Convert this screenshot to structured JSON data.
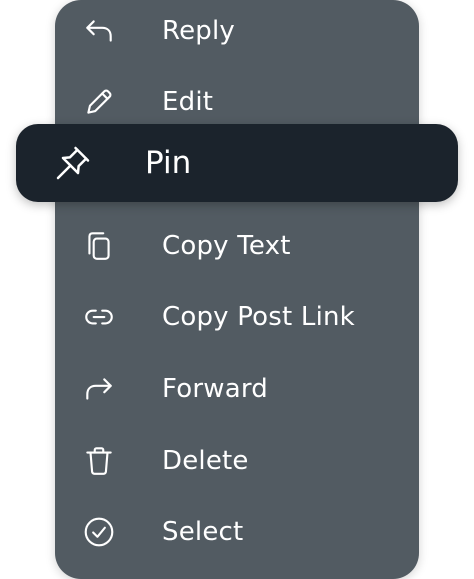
{
  "colors": {
    "menu_background": "#525b62",
    "highlight_background": "#1b232c",
    "text": "#ffffff",
    "page_background": "#ffffff"
  },
  "menu": {
    "items": [
      {
        "label": "Reply",
        "icon": "reply-icon"
      },
      {
        "label": "Edit",
        "icon": "pencil-icon"
      },
      {
        "label": "Pin",
        "icon": "pin-icon",
        "highlighted": true
      },
      {
        "label": "Copy Text",
        "icon": "copy-icon"
      },
      {
        "label": "Copy Post Link",
        "icon": "link-icon"
      },
      {
        "label": "Forward",
        "icon": "forward-icon"
      },
      {
        "label": "Delete",
        "icon": "trash-icon"
      },
      {
        "label": "Select",
        "icon": "check-circle-icon"
      }
    ]
  }
}
